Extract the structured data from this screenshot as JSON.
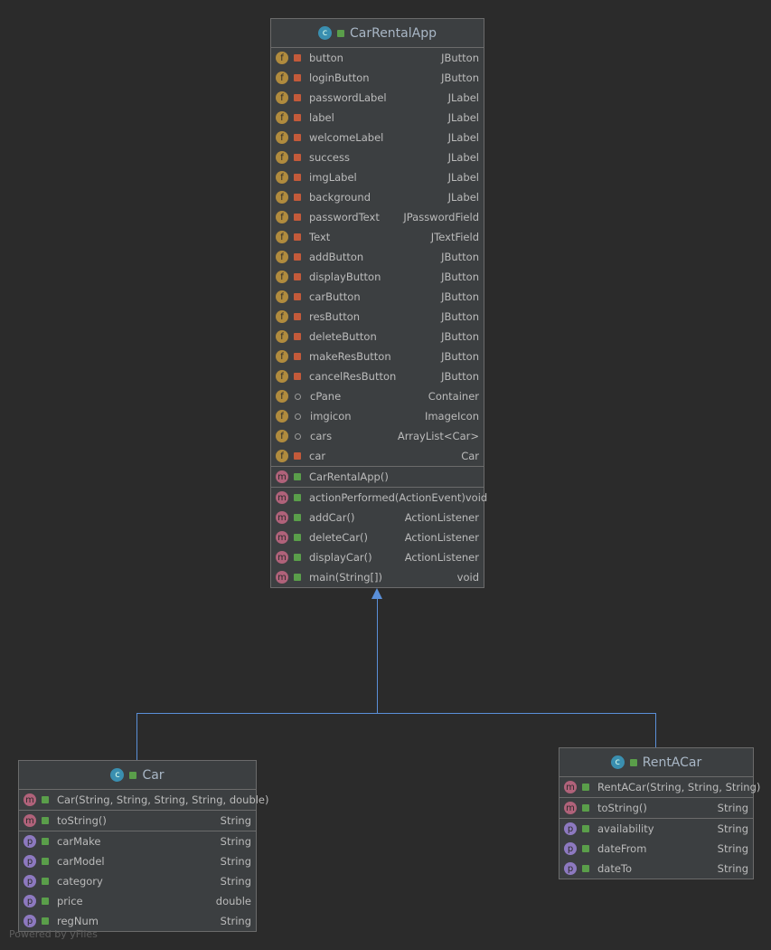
{
  "classes": [
    {
      "id": "carrentalapp",
      "name": "CarRentalApp",
      "sections": [
        [
          {
            "kind": "f",
            "vis": "private",
            "name": "button",
            "type": "JButton"
          },
          {
            "kind": "f",
            "vis": "private",
            "name": "loginButton",
            "type": "JButton"
          },
          {
            "kind": "f",
            "vis": "private",
            "name": "passwordLabel",
            "type": "JLabel"
          },
          {
            "kind": "f",
            "vis": "private",
            "name": "label",
            "type": "JLabel"
          },
          {
            "kind": "f",
            "vis": "private",
            "name": "welcomeLabel",
            "type": "JLabel"
          },
          {
            "kind": "f",
            "vis": "private",
            "name": "success",
            "type": "JLabel"
          },
          {
            "kind": "f",
            "vis": "private",
            "name": "imgLabel",
            "type": "JLabel"
          },
          {
            "kind": "f",
            "vis": "private",
            "name": "background",
            "type": "JLabel"
          },
          {
            "kind": "f",
            "vis": "private",
            "name": "passwordText",
            "type": "JPasswordField"
          },
          {
            "kind": "f",
            "vis": "private",
            "name": "Text",
            "type": "JTextField"
          },
          {
            "kind": "f",
            "vis": "private",
            "name": "addButton",
            "type": "JButton"
          },
          {
            "kind": "f",
            "vis": "private",
            "name": "displayButton",
            "type": "JButton"
          },
          {
            "kind": "f",
            "vis": "private",
            "name": "carButton",
            "type": "JButton"
          },
          {
            "kind": "f",
            "vis": "private",
            "name": "resButton",
            "type": "JButton"
          },
          {
            "kind": "f",
            "vis": "private",
            "name": "deleteButton",
            "type": "JButton"
          },
          {
            "kind": "f",
            "vis": "private",
            "name": "makeResButton",
            "type": "JButton"
          },
          {
            "kind": "f",
            "vis": "private",
            "name": "cancelResButton",
            "type": "JButton"
          },
          {
            "kind": "f",
            "vis": "package",
            "name": "cPane",
            "type": "Container"
          },
          {
            "kind": "f",
            "vis": "package",
            "name": "imgicon",
            "type": "ImageIcon"
          },
          {
            "kind": "f",
            "vis": "package",
            "name": "cars",
            "type": "ArrayList<Car>"
          },
          {
            "kind": "f",
            "vis": "private",
            "name": "car",
            "type": "Car"
          }
        ],
        [
          {
            "kind": "m",
            "vis": "public",
            "name": "CarRentalApp()",
            "type": ""
          }
        ],
        [
          {
            "kind": "m",
            "vis": "public",
            "name": "actionPerformed(ActionEvent)",
            "type": "void"
          },
          {
            "kind": "m",
            "vis": "public",
            "name": "addCar()",
            "type": "ActionListener"
          },
          {
            "kind": "m",
            "vis": "public",
            "name": "deleteCar()",
            "type": "ActionListener"
          },
          {
            "kind": "m",
            "vis": "public",
            "name": "displayCar()",
            "type": "ActionListener"
          },
          {
            "kind": "m",
            "vis": "public",
            "name": "main(String[])",
            "type": "void"
          }
        ]
      ]
    },
    {
      "id": "car",
      "name": "Car",
      "sections": [
        [
          {
            "kind": "m",
            "vis": "public",
            "name": "Car(String, String, String, String, double)",
            "type": ""
          }
        ],
        [
          {
            "kind": "m",
            "vis": "public",
            "name": "toString()",
            "type": "String"
          }
        ],
        [
          {
            "kind": "p",
            "vis": "public",
            "name": "carMake",
            "type": "String"
          },
          {
            "kind": "p",
            "vis": "public",
            "name": "carModel",
            "type": "String"
          },
          {
            "kind": "p",
            "vis": "public",
            "name": "category",
            "type": "String"
          },
          {
            "kind": "p",
            "vis": "public",
            "name": "price",
            "type": "double"
          },
          {
            "kind": "p",
            "vis": "public",
            "name": "regNum",
            "type": "String"
          }
        ]
      ]
    },
    {
      "id": "rentacar",
      "name": "RentACar",
      "sections": [
        [
          {
            "kind": "m",
            "vis": "public",
            "name": "RentACar(String, String, String)",
            "type": ""
          }
        ],
        [
          {
            "kind": "m",
            "vis": "public",
            "name": "toString()",
            "type": "String"
          }
        ],
        [
          {
            "kind": "p",
            "vis": "public",
            "name": "availability",
            "type": "String"
          },
          {
            "kind": "p",
            "vis": "public",
            "name": "dateFrom",
            "type": "String"
          },
          {
            "kind": "p",
            "vis": "public",
            "name": "dateTo",
            "type": "String"
          }
        ]
      ]
    }
  ],
  "footer": "Powered by yFiles",
  "colors": {
    "edge": "#5a8fd8",
    "background": "#2b2b2b",
    "node": "#3c3f41"
  }
}
